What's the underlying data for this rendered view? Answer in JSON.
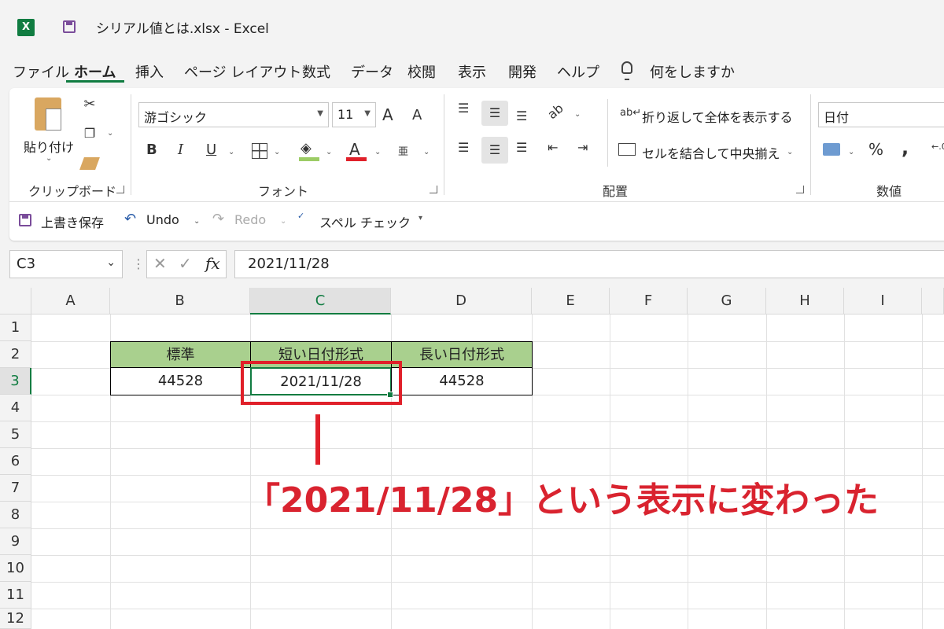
{
  "window": {
    "title": "シリアル値とは.xlsx  -  Excel",
    "app_logo": "X"
  },
  "menu": {
    "items": [
      "ファイル",
      "ホーム",
      "挿入",
      "ページ レイアウト",
      "数式",
      "データ",
      "校閲",
      "表示",
      "開発",
      "ヘルプ"
    ],
    "active": "ホーム",
    "tell_me": "何をしますか"
  },
  "ribbon": {
    "clipboard": {
      "paste": "貼り付け",
      "group": "クリップボード"
    },
    "font": {
      "name": "游ゴシック",
      "size": "11",
      "bold": "B",
      "italic": "I",
      "underline": "U",
      "grow": "A",
      "shrink": "A",
      "color_a": "A",
      "group": "フォント",
      "phonetic": "亜"
    },
    "alignment": {
      "wrap": "折り返して全体を表示する",
      "merge": "セルを結合して中央揃え",
      "group": "配置"
    },
    "number": {
      "format": "日付",
      "percent": "%",
      "comma": ",",
      "group": "数値"
    }
  },
  "qat": {
    "save": "上書き保存",
    "undo": "Undo",
    "redo": "Redo",
    "spell": "スペル チェック"
  },
  "formula_bar": {
    "name_box": "C3",
    "fx": "fx",
    "value": "2021/11/28"
  },
  "columns": [
    "A",
    "B",
    "C",
    "D",
    "E",
    "F",
    "G",
    "H",
    "I"
  ],
  "rows": [
    "1",
    "2",
    "3",
    "4",
    "5",
    "6",
    "7",
    "8",
    "9",
    "10",
    "11",
    "12"
  ],
  "table": {
    "headers": [
      "標準",
      "短い日付形式",
      "長い日付形式"
    ],
    "values": [
      "44528",
      "2021/11/28",
      "44528"
    ]
  },
  "annotation": "「2021/11/28」という表示に変わった",
  "colors": {
    "accent": "#107c41",
    "header_fill": "#a9d08e",
    "annotation": "#e0202a"
  }
}
